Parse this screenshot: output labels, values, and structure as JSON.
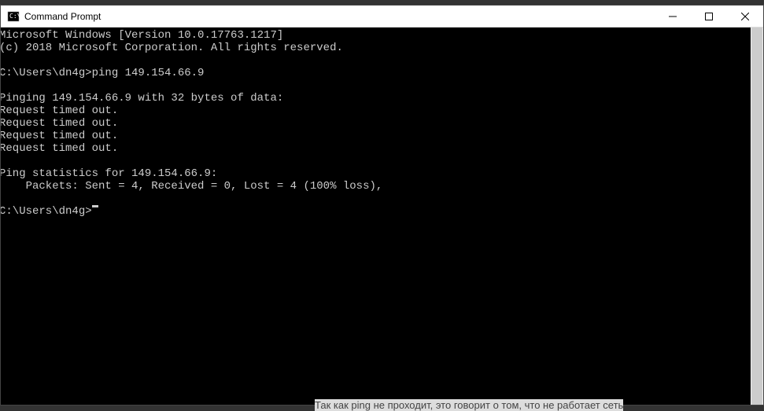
{
  "window": {
    "title": "Command Prompt"
  },
  "terminal": {
    "lines": [
      "Microsoft Windows [Version 10.0.17763.1217]",
      "(c) 2018 Microsoft Corporation. All rights reserved.",
      "",
      "C:\\Users\\dn4g>ping 149.154.66.9",
      "",
      "Pinging 149.154.66.9 with 32 bytes of data:",
      "Request timed out.",
      "Request timed out.",
      "Request timed out.",
      "Request timed out.",
      "",
      "Ping statistics for 149.154.66.9:",
      "    Packets: Sent = 4, Received = 0, Lost = 4 (100% loss),",
      ""
    ],
    "prompt": "C:\\Users\\dn4g>"
  },
  "bottom_text": "Так как ping не проходит, это говорит о том, что не работает сеть"
}
